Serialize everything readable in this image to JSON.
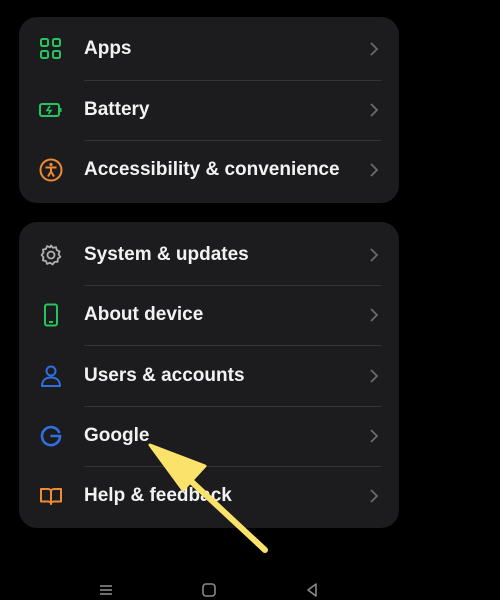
{
  "colors": {
    "background": "#000000",
    "card": "#1c1c1e",
    "divider": "#343436",
    "text": "#f2f2f2",
    "chevron": "#6b6b6e",
    "green": "#22c55e",
    "orange": "#f08a34",
    "blue": "#2f6fe0",
    "gray_icon": "#b0b0b0",
    "annotation_arrow": "#fbe26a"
  },
  "settings_group_1": {
    "items": [
      {
        "label": "Apps",
        "icon": "apps-grid-icon",
        "icon_color": "#22c55e"
      },
      {
        "label": "Battery",
        "icon": "battery-icon",
        "icon_color": "#22c55e"
      },
      {
        "label": "Accessibility & convenience",
        "icon": "accessibility-icon",
        "icon_color": "#f08a34"
      }
    ]
  },
  "settings_group_2": {
    "items": [
      {
        "label": "System & updates",
        "icon": "gear-icon",
        "icon_color": "#b0b0b0"
      },
      {
        "label": "About device",
        "icon": "phone-icon",
        "icon_color": "#22c55e"
      },
      {
        "label": "Users & accounts",
        "icon": "user-icon",
        "icon_color": "#2f6fe0"
      },
      {
        "label": "Google",
        "icon": "google-icon",
        "icon_color": "#2f6fe0"
      },
      {
        "label": "Help & feedback",
        "icon": "help-book-icon",
        "icon_color": "#f08a34"
      }
    ]
  },
  "nav_bar": {
    "buttons": [
      "menu-icon",
      "home-icon",
      "back-icon"
    ]
  },
  "annotation": {
    "type": "arrow",
    "points_to": "Google"
  }
}
